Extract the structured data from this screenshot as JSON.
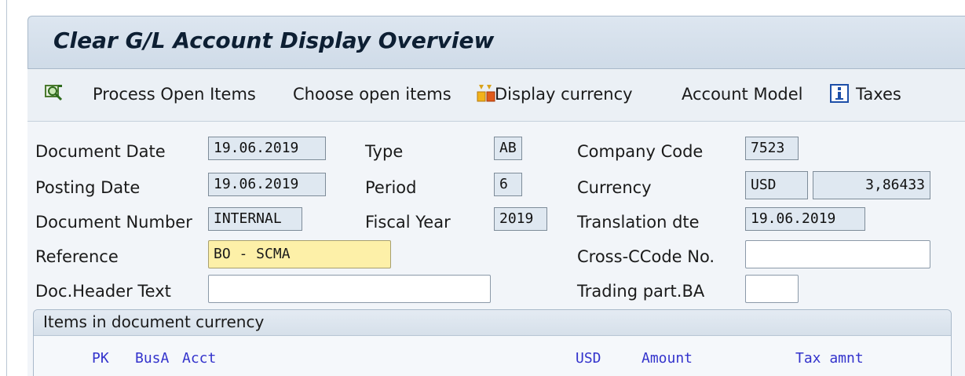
{
  "title": "Clear G/L Account Display Overview",
  "toolbar": {
    "process_open_items": "Process Open Items",
    "choose_open_items": "Choose open items",
    "display_currency": "Display currency",
    "account_model": "Account Model",
    "taxes": "Taxes"
  },
  "header": {
    "document_date": {
      "label": "Document Date",
      "value": "19.06.2019"
    },
    "posting_date": {
      "label": "Posting Date",
      "value": "19.06.2019"
    },
    "document_number": {
      "label": "Document Number",
      "value": "INTERNAL"
    },
    "reference": {
      "label": "Reference",
      "value": "BO - SCMA"
    },
    "doc_header_text": {
      "label": "Doc.Header Text",
      "value": ""
    },
    "type": {
      "label": "Type",
      "value": "AB"
    },
    "period": {
      "label": "Period",
      "value": "6"
    },
    "fiscal_year": {
      "label": "Fiscal Year",
      "value": "2019"
    },
    "company_code": {
      "label": "Company Code",
      "value": "7523"
    },
    "currency": {
      "label": "Currency",
      "value": "USD",
      "rate": "3,86433"
    },
    "translation_date": {
      "label": "Translation dte",
      "value": "19.06.2019"
    },
    "cross_ccode_no": {
      "label": "Cross-CCode No.",
      "value": ""
    },
    "trading_part_ba": {
      "label": "Trading part.BA",
      "value": ""
    }
  },
  "items": {
    "title": "Items in document currency",
    "columns": {
      "pk": "PK",
      "busa": "BusA",
      "acct": "Acct",
      "currency": "USD",
      "amount": "Amount",
      "tax_amount": "Tax amnt"
    }
  },
  "colors": {
    "title_bar": "#d6e0ec",
    "highlight_field": "#fdf0a8",
    "column_header_text": "#3333cc"
  }
}
